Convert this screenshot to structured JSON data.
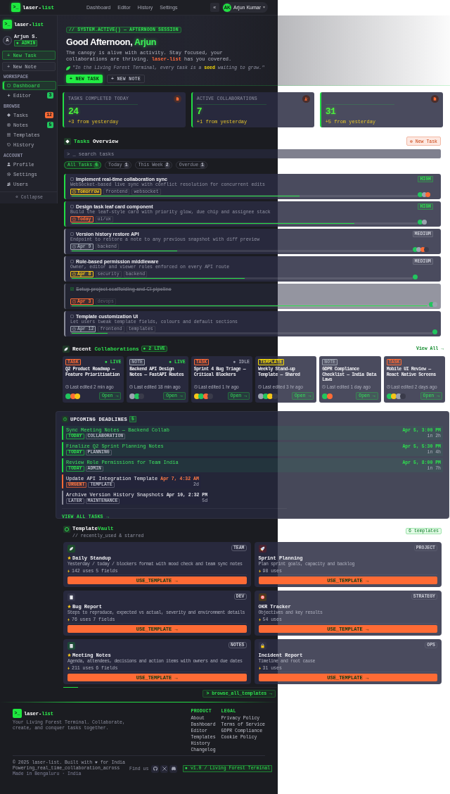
{
  "topbar": {
    "logo_mark": ">_",
    "brand": "laser-",
    "brand_accent": "list",
    "nav": [
      {
        "label": "Dashboard"
      },
      {
        "label": "Editor"
      },
      {
        "label": "History"
      },
      {
        "label": "Settings"
      }
    ],
    "toggle": "«",
    "user": {
      "initials": "AK",
      "name": "Arjun Kumar"
    }
  },
  "sidebar": {
    "logo_mark": ">_",
    "brand": "laser-",
    "brand_accent": "list",
    "user": {
      "initial": "A",
      "name": "Arjun S.",
      "role": "● ADMIN"
    },
    "actions": [
      {
        "label": "+ New Task",
        "kind": "primary"
      },
      {
        "label": "+ New Note",
        "kind": "secondary"
      }
    ],
    "sections": [
      {
        "title": "WORKSPACE",
        "items": [
          {
            "label": "Dashboard",
            "selected": true
          },
          {
            "label": "Editor",
            "selected": false,
            "badge": "3",
            "color": "#22c55e"
          }
        ]
      },
      {
        "title": "BROWSE",
        "items": [
          {
            "label": "Tasks",
            "selected": false,
            "badge": "12",
            "color": "#ff6b35"
          },
          {
            "label": "Notes",
            "selected": false,
            "badge": "5",
            "color": "#22c55e"
          },
          {
            "label": "Templates",
            "selected": false
          },
          {
            "label": "History",
            "selected": false
          }
        ]
      },
      {
        "title": "ACCOUNT",
        "items": [
          {
            "label": "Profile",
            "selected": false
          },
          {
            "label": "Settings",
            "selected": false
          },
          {
            "label": "Users",
            "selected": false
          }
        ]
      }
    ],
    "collapse": "« Collapse"
  },
  "hero": {
    "tag": "// SYSTEM.ACTIVE() — AFTERNOON SESSION",
    "greeting": "Good Afternoon, ",
    "name": "Arjun",
    "text": "The canopy is alive with activity. Stay focused, your collaborations are thriving. **laser-list** has you covered.",
    "quote": "\"In the Living Forest Terminal, every task is a **seed** waiting to grow.\"",
    "buttons": [
      {
        "label": "+ NEW TASK",
        "kind": "primary"
      },
      {
        "label": "+ NEW NOTE",
        "kind": "ghost"
      }
    ]
  },
  "stats": [
    {
      "label": "TASKS COMPLETED TODAY",
      "value": "24",
      "delta": "+3 from yesterday"
    },
    {
      "label": "ACTIVE COLLABORATIONS",
      "value": "7",
      "delta": "+1 from yesterday"
    },
    {
      "value": "31",
      "delta": "+5 from yesterday"
    }
  ],
  "tasks": {
    "title": "Tasks",
    "title_rest": " Overview",
    "new_button": "⊕ New Task",
    "search_placeholder": "> _ search tasks",
    "filters": [
      {
        "label": "All Tasks",
        "count": "6",
        "selected": true
      },
      {
        "label": "Today",
        "count": "1",
        "selected": false
      },
      {
        "label": "This Week",
        "count": "2",
        "selected": false
      },
      {
        "label": "Overdue",
        "count": "1",
        "selected": false
      }
    ],
    "items": [
      {
        "title": "Implement real-time collaboration sync",
        "description": "WebSocket-based live sync with conflict resolution for concurrent edits",
        "done": false,
        "priority": {
          "text": "HIGH",
          "kind": "high"
        },
        "due": {
          "text": "Tomorrow",
          "color": "#f5c518"
        },
        "tags": [
          "frontend",
          "websocket"
        ],
        "level": 0.66,
        "color": "#22dd44",
        "avatars": [
          {
            "color": "#22c55e"
          },
          {
            "color": "#9ca3af"
          },
          {
            "color": "#ff6b35"
          }
        ]
      },
      {
        "title": "Design task leaf card component",
        "description": "Build the leaf-style card with priority glow, due chip and assignee stack",
        "done": false,
        "priority": {
          "text": "HIGH",
          "kind": "high"
        },
        "due": {
          "text": "Today",
          "color": "#ff6b35"
        },
        "tags": [
          "ui/ux"
        ],
        "level": 0.82,
        "color": "#22dd44",
        "avatars": [
          {
            "color": "#22c55e"
          },
          {
            "color": "#9ca3af"
          }
        ]
      },
      {
        "title": "Version history restore API",
        "description": "Endpoint to restore a note to any previous snapshot with diff preview",
        "done": false,
        "priority": {
          "text": "MEDIUM",
          "kind": "medium"
        },
        "due": {
          "text": "Apr 9",
          "color": "#9ca3af"
        },
        "tags": [
          "backend"
        ],
        "level": 0.31,
        "color": "#8a8c99",
        "avatars": [
          {
            "color": "#22c55e"
          },
          {
            "color": "#9ca3af"
          },
          {
            "color": "#ff6b35"
          },
          {
            "color": "#3a3b4a"
          }
        ]
      },
      {
        "title": "Role-based permission middleware",
        "description": "Owner, editor and viewer roles enforced on every API route",
        "done": false,
        "priority": {
          "text": "MEDIUM",
          "kind": "medium"
        },
        "due": {
          "text": "Apr 8",
          "color": "#f5c518"
        },
        "tags": [
          "security",
          "backend"
        ],
        "level": 0.51,
        "color": "#8a8c99",
        "avatars": [
          {
            "color": "#22c55e"
          }
        ]
      },
      {
        "title": "Setup project scaffolding and CI pipeline",
        "done": true,
        "due": {
          "text": "Apr 3",
          "color": "#ff6b35"
        },
        "tags": [
          "devops"
        ],
        "level": 1,
        "color": "#5a5c6a",
        "avatars": [
          {
            "color": "#22c55e"
          },
          {
            "color": "#9ca3af"
          }
        ]
      },
      {
        "title": "Template customization UI",
        "description": "Let users tweak template fields, colours and default sections",
        "done": false,
        "due": {
          "text": "Apr 12",
          "color": "#9ca3af"
        },
        "tags": [
          "frontend",
          "templates"
        ],
        "level": 0.1,
        "color": "#8a8c99",
        "avatars": [
          {
            "color": "#22c55e"
          }
        ]
      }
    ]
  },
  "collabs": {
    "title": "Recent ",
    "accent": "Collaborations",
    "live_badge": "● 2 LIVE",
    "view_all": "View All →",
    "items": [
      {
        "type": "TASK",
        "color": "#ff6b35",
        "status": "● LIVE",
        "live": true,
        "title": "Q2 Product Roadmap — Feature Prioritisation",
        "edited": "Last edited 2 min ago",
        "open": "Open →",
        "avatars": [
          {
            "color": "#22c55e"
          },
          {
            "color": "#ff6b35"
          },
          {
            "color": "#f5c518"
          }
        ]
      },
      {
        "type": "NOTE",
        "color": "#9ca3af",
        "status": "● LIVE",
        "live": true,
        "title": "Backend API Design Notes — FastAPI Routes",
        "edited": "Last edited 18 min ago",
        "open": "Open →",
        "avatars": [
          {
            "color": "#9ca3af"
          },
          {
            "color": "#22c55e"
          },
          {
            "color": "#3a3b4a"
          }
        ]
      },
      {
        "type": "TASK",
        "color": "#ff6b35",
        "status": "● IDLE",
        "live": false,
        "title": "Sprint 4 Bug Triage — Critical Blockers",
        "edited": "Last edited 1 hr ago",
        "open": "Open →",
        "avatars": [
          {
            "color": "#f5c518"
          },
          {
            "color": "#22c55e"
          },
          {
            "color": "#ff6b35"
          },
          {
            "color": "#3a3b4a"
          }
        ]
      },
      {
        "type": "TEMPLATE",
        "color": "#f5d90a",
        "title": "Weekly Stand-up Template — Shared",
        "edited": "Last edited 3 hr ago",
        "open": "Open →",
        "avatars": [
          {
            "color": "#9ca3af"
          },
          {
            "color": "#22c55e"
          },
          {
            "color": "#f5c518"
          },
          {
            "color": "#3a3b4a"
          }
        ]
      },
      {
        "type": "NOTE",
        "color": "#9ca3af",
        "title": "GDPR Compliance Checklist — India Data Laws",
        "edited": "Last edited 1 day ago",
        "open": "Open →",
        "avatars": [
          {
            "color": "#22c55e"
          },
          {
            "color": "#ff6b35"
          }
        ]
      },
      {
        "type": "TASK",
        "color": "#ff6b35",
        "title": "Mobile UI Review — React Native Screens",
        "edited": "Last edited 2 days ago",
        "open": "Open →",
        "avatars": [
          {
            "color": "#22c55e"
          },
          {
            "color": "#f5c518"
          },
          {
            "color": "#9ca3af"
          },
          {
            "color": "#3a3b4a"
          }
        ]
      }
    ]
  },
  "deadlines": {
    "title": "UPCOMING DEADLINES",
    "count": "5",
    "items": [
      {
        "kind": "today",
        "title": "Sync Meeting Notes — Backend Collab",
        "tags": [
          {
            "text": "TODAY",
            "kind": "today"
          },
          {
            "text": "COLLABORATION",
            "kind": "plain"
          }
        ],
        "date": "Apr 5, 3:00 PM",
        "note": "in 2h"
      },
      {
        "kind": "today",
        "title": "Finalize Q2 Sprint Planning Notes",
        "tags": [
          {
            "text": "TODAY",
            "kind": "today"
          },
          {
            "text": "PLANNING",
            "kind": "plain"
          }
        ],
        "date": "Apr 5, 5:30 PM",
        "note": "in 4h"
      },
      {
        "kind": "today",
        "title": "Review Role Permissions for Team India",
        "tags": [
          {
            "text": "TODAY",
            "kind": "today"
          },
          {
            "text": "ADMIN",
            "kind": "plain"
          }
        ],
        "date": "Apr 5, 8:00 PM",
        "note": "in 7h"
      },
      {
        "kind": "urgent",
        "title": "Update API Integration Template",
        "tags": [
          {
            "text": "URGENT",
            "kind": "urgent"
          },
          {
            "text": "TEMPLATE",
            "kind": "plain"
          }
        ],
        "date": "Apr 7, 4:32 AM",
        "note": "2d"
      },
      {
        "kind": "later",
        "title": "Archive Version History Snapshots",
        "tags": [
          {
            "text": "LATER",
            "kind": "plain"
          },
          {
            "text": "MAINTENANCE",
            "kind": "plain"
          }
        ],
        "date": "Apr 10, 2:32 PM",
        "note": "5d"
      }
    ],
    "view_all": "VIEW ALL TASKS →"
  },
  "vault": {
    "title": "Template",
    "accent": "Vault",
    "subtitle": "// recently_used & starred",
    "count": "6 templates",
    "items": [
      {
        "tag": "TEAM",
        "title": "Daily Standup",
        "starred": true,
        "color": "#1d4a2c",
        "description": "Yesterday / today / blockers format with mood check and team sync notes",
        "uses": "142 uses",
        "fields": "5 fields",
        "button": "USE_TEMPLATE →"
      },
      {
        "tag": "PROJECT",
        "title": "Sprint Planning",
        "starred": false,
        "color": "#4a2230",
        "description": "Plan sprint goals, capacity and backlog",
        "uses": "98 uses",
        "button": "USE_TEMPLATE →"
      },
      {
        "tag": "DEV",
        "title": "Bug Report",
        "starred": true,
        "color": "#34354a",
        "description": "Steps to reproduce, expected vs actual, severity and environment details",
        "uses": "76 uses",
        "fields": "7 fields",
        "button": "USE_TEMPLATE →"
      },
      {
        "tag": "STRATEGY",
        "title": "OKR Tracker",
        "starred": false,
        "color": "#4a3a1e",
        "description": "Objectives and key results",
        "uses": "54 uses",
        "button": "USE_TEMPLATE →"
      },
      {
        "tag": "NOTES",
        "title": "Meeting Notes",
        "starred": true,
        "color": "#1d4a38",
        "description": "Agenda, attendees, decisions and action items with owners and due dates",
        "uses": "211 uses",
        "fields": "6 fields",
        "button": "USE_TEMPLATE →"
      },
      {
        "tag": "OPS",
        "title": "Incident Report",
        "starred": false,
        "color": "#303146",
        "description": "Timeline and root cause",
        "uses": "31 uses",
        "button": "USE_TEMPLATE →"
      }
    ],
    "browse": "> browse_all_templates →"
  },
  "footer": {
    "logo_mark": ">_",
    "brand": "laser-",
    "brand_accent": "list",
    "tagline": "Your Living Forest Terminal. Collaborate, create, and conquer tasks together.",
    "columns": [
      {
        "title": "PRODUCT",
        "links": [
          "About",
          "Dashboard",
          "Editor",
          "Templates",
          "History",
          "Changelog"
        ]
      },
      {
        "title": "LEGAL",
        "links": [
          "Privacy Policy",
          "Terms of Service",
          "GDPR Compliance",
          "Cookie Policy"
        ]
      }
    ],
    "copyright": "© 2025 laser-list. Built with ♥ for India",
    "line2": "Powering_real_time_collaboration_across",
    "line3": "Made in Bengaluru · India",
    "find_us": "Find us",
    "version": "● v1.0 / Living Forest Terminal"
  }
}
